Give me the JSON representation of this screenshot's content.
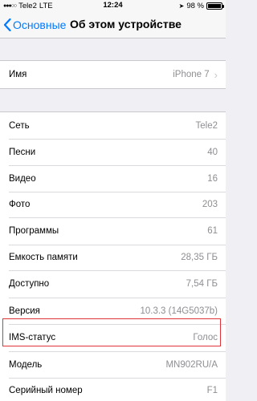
{
  "status_bar": {
    "carrier": "Tele2",
    "network": "LTE",
    "time": "12:24",
    "battery_percent": "98 %",
    "battery_level": 0.98
  },
  "nav": {
    "back_label": "Основные",
    "title": "Об этом устройстве"
  },
  "name_row": {
    "label": "Имя",
    "value": "iPhone 7"
  },
  "rows": [
    {
      "label": "Сеть",
      "value": "Tele2"
    },
    {
      "label": "Песни",
      "value": "40"
    },
    {
      "label": "Видео",
      "value": "16"
    },
    {
      "label": "Фото",
      "value": "203"
    },
    {
      "label": "Программы",
      "value": "61"
    },
    {
      "label": "Емкость памяти",
      "value": "28,35 ГБ"
    },
    {
      "label": "Доступно",
      "value": "7,54 ГБ"
    },
    {
      "label": "Версия",
      "value": "10.3.3 (14G5037b)"
    },
    {
      "label": "IMS-статус",
      "value": "Голос"
    },
    {
      "label": "Модель",
      "value": "MN902RU/A"
    },
    {
      "label": "Серийный номер",
      "value": "F1"
    }
  ],
  "colors": {
    "accent": "#007aff",
    "highlight": "#e0343a"
  }
}
